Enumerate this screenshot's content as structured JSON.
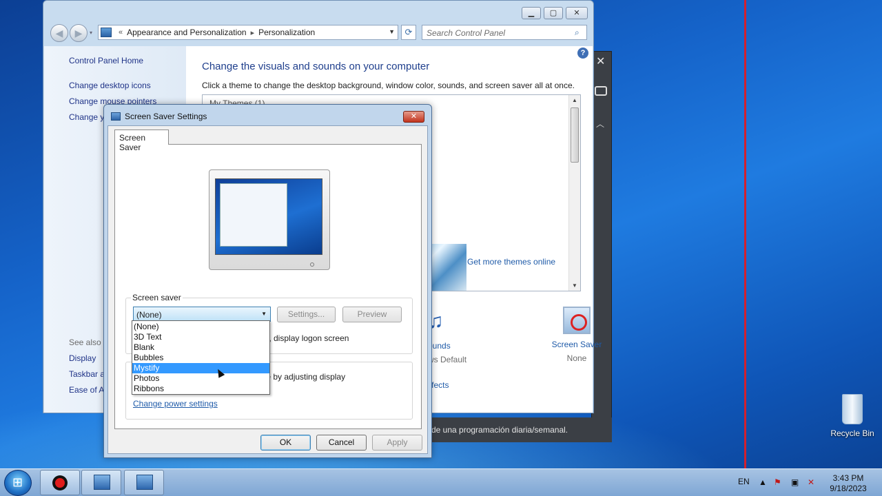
{
  "control_panel": {
    "breadcrumb": [
      "Appearance and Personalization",
      "Personalization"
    ],
    "search_placeholder": "Search Control Panel",
    "left_links": [
      "Control Panel Home",
      "Change desktop icons",
      "Change mouse pointers",
      "Change y"
    ],
    "see_also_label": "See also",
    "see_also_links": [
      "Display",
      "Taskbar a",
      "Ease of Ac"
    ],
    "main_title": "Change the visuals and sounds on your computer",
    "main_desc": "Click a theme to change the desktop background, window color, sounds, and screen saver all at once.",
    "themes_header": "My Themes (1)",
    "theme_link_partial": "heme",
    "theme_link_online": "Get more themes online",
    "sounds_label": "ounds",
    "sounds_sub": "ws Default",
    "screen_saver_label": "Screen Saver",
    "screen_saver_sub": "None",
    "effects_link": "ffects"
  },
  "background_window": {
    "text": "de una programación diaria/semanal."
  },
  "dialog": {
    "title": "Screen Saver Settings",
    "tab": "Screen Saver",
    "group_label": "Screen saver",
    "selected": "(None)",
    "settings_button": "Settings...",
    "preview_button": "Preview",
    "logon_text": "ume, display logon screen",
    "power_text": "ance by adjusting display",
    "power_link": "Change power settings",
    "ok": "OK",
    "cancel": "Cancel",
    "apply": "Apply"
  },
  "dropdown": {
    "options": [
      "(None)",
      "3D Text",
      "Blank",
      "Bubbles",
      "Mystify",
      "Photos",
      "Ribbons"
    ],
    "highlighted": "Mystify"
  },
  "desktop": {
    "recycle_bin": "Recycle Bin"
  },
  "taskbar": {
    "language": "EN",
    "time": "3:43 PM",
    "date": "9/18/2023"
  }
}
